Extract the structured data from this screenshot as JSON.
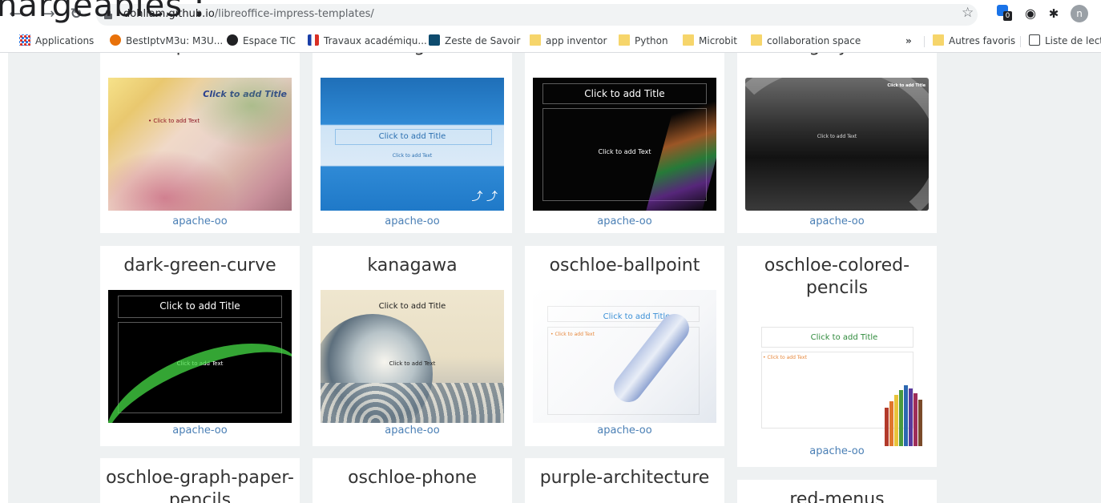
{
  "overlay_title": "hargeables :",
  "browser": {
    "url_host": "dohliam.github.io",
    "url_path": "/libreoffice-impress-templates/",
    "ext_badge": "0",
    "avatar_letter": "n"
  },
  "bookmarks": [
    {
      "label": "Applications",
      "icon": "apps"
    },
    {
      "label": "BestIptvM3u: M3U...",
      "icon": "site"
    },
    {
      "label": "Espace TIC",
      "icon": "site"
    },
    {
      "label": "Travaux académiqu...",
      "icon": "site"
    },
    {
      "label": "Zeste de Savoir",
      "icon": "site"
    },
    {
      "label": "app inventor",
      "icon": "folder"
    },
    {
      "label": "Python",
      "icon": "folder"
    },
    {
      "label": "Microbit",
      "icon": "folder"
    },
    {
      "label": "collaboration space",
      "icon": "folder"
    }
  ],
  "bookmarks_more": "»",
  "bookmarks_right": [
    {
      "label": "Autres favoris",
      "icon": "folder"
    },
    {
      "label": "Liste de lectu",
      "icon": "reading-list"
    }
  ],
  "templates": [
    {
      "name": "aquarelle",
      "source": "apache-oo",
      "slide_title": "Click to add Title",
      "slide_text": "• Click to add Text"
    },
    {
      "name": "blue-gulls",
      "source": "apache-oo",
      "slide_title": "Click to add Title",
      "slide_text": "Click to add Text"
    },
    {
      "name": "dark-fade",
      "source": "apache-oo",
      "slide_title": "Click to add Title",
      "slide_text": "Click to add Text"
    },
    {
      "name": "dark-gray-crawls",
      "source": "apache-oo",
      "slide_title": "Click to add Title",
      "slide_text": "Click to add Text"
    },
    {
      "name": "dark-green-curve",
      "source": "apache-oo",
      "slide_title": "Click to add Title",
      "slide_text": "Click to add Text"
    },
    {
      "name": "kanagawa",
      "source": "apache-oo",
      "slide_title": "Click to add Title",
      "slide_text": "Click to add Text"
    },
    {
      "name": "oschloe-ballpoint",
      "source": "apache-oo",
      "slide_title": "Click to add Title",
      "slide_text": "• Click to add Text"
    },
    {
      "name": "oschloe-colored-pencils",
      "source": "apache-oo",
      "slide_title": "Click to add Title",
      "slide_text": "• Click to add Text"
    },
    {
      "name": "oschloe-graph-paper-pencils"
    },
    {
      "name": "oschloe-phone"
    },
    {
      "name": "purple-architecture"
    },
    {
      "name": "red-menus"
    }
  ]
}
